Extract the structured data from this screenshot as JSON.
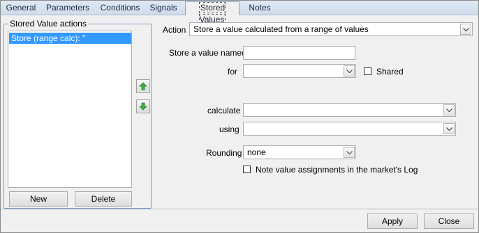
{
  "tabs": [
    {
      "label": "General"
    },
    {
      "label": "Parameters"
    },
    {
      "label": "Conditions"
    },
    {
      "label": "Signals"
    },
    {
      "label": "Stored Values",
      "active": true
    },
    {
      "label": "Notes"
    }
  ],
  "group": {
    "title": "Stored Value actions",
    "items": [
      "Store (range calc): ''"
    ],
    "new_label": "New",
    "delete_label": "Delete"
  },
  "form": {
    "action_label": "Action",
    "action_value": "Store a value calculated from a range of values",
    "store_name_label": "Store a value named",
    "store_name_value": "",
    "for_label": "for",
    "for_value": "",
    "shared_label": "Shared",
    "shared_checked": false,
    "calculate_label": "calculate",
    "calculate_value": "",
    "using_label": "using",
    "using_value": "",
    "rounding_label": "Rounding",
    "rounding_value": "none",
    "note_label": "Note value assignments in the market's Log",
    "note_checked": false
  },
  "footer": {
    "apply_label": "Apply",
    "close_label": "Close"
  },
  "colors": {
    "selection": "#3399ff",
    "arrow": "#2e9a2e"
  }
}
